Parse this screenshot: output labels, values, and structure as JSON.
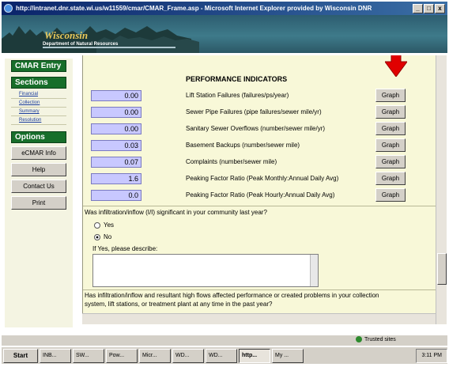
{
  "window": {
    "title": "http://intranet.dnr.state.wi.us/w11559/cmar/CMAR_Frame.asp - Microsoft Internet Explorer provided by Wisconsin DNR",
    "buttons": [
      "_",
      "□",
      "x"
    ]
  },
  "banner": {
    "name": "Wisconsin",
    "dept": "Department of Natural Resources"
  },
  "sidebar": {
    "entry_title": "CMAR Entry",
    "sections_title": "Sections",
    "sections": [
      "Financial",
      "Collection",
      "Summary",
      "Resolution"
    ],
    "options_title": "Options",
    "option_buttons": [
      "eCMAR Info",
      "Help",
      "Contact Us",
      "Print"
    ]
  },
  "main": {
    "heading": "PERFORMANCE INDICATORS",
    "graph_label": "Graph",
    "indicators": [
      {
        "value": "0.00",
        "label": "Lift Station Failures (failures/ps/year)"
      },
      {
        "value": "0.00",
        "label": "Sewer Pipe Failures (pipe failures/sewer mile/yr)"
      },
      {
        "value": "0.00",
        "label": "Sanitary Sewer Overflows (number/sewer mile/yr)"
      },
      {
        "value": "0.03",
        "label": "Basement Backups (number/sewer mile)"
      },
      {
        "value": "0.07",
        "label": "Complaints (number/sewer mile)"
      },
      {
        "value": "1.6",
        "label": "Peaking Factor Ratio (Peak Monthly:Annual Daily Avg)"
      },
      {
        "value": "0.0",
        "label": "Peaking Factor Ratio (Peak Hourly:Annual Daily Avg)"
      }
    ],
    "question1": "Was infiltration/inflow (I/I) significant in your community last year?",
    "yes_label": "Yes",
    "no_label": "No",
    "selected": "No",
    "describe_label": "If Yes, please describe:",
    "question2_line1": "Has infiltration/inflow and resultant high flows affected performance or created problems in your collection",
    "question2_line2": "system, lift stations, or treatment plant at any time in the past year?"
  },
  "status": {
    "zone": "Trusted sites"
  },
  "taskbar": {
    "start": "Start",
    "tasks": [
      "INB...",
      "SW...",
      "Pow...",
      "Micr...",
      "WD...",
      "WD...",
      "http...",
      "My ..."
    ],
    "active_index": 6,
    "clock": "3:11 PM"
  },
  "colors": {
    "accent_green": "#176e2a",
    "value_field": "#c8c8ff",
    "arrow": "#e00000"
  }
}
